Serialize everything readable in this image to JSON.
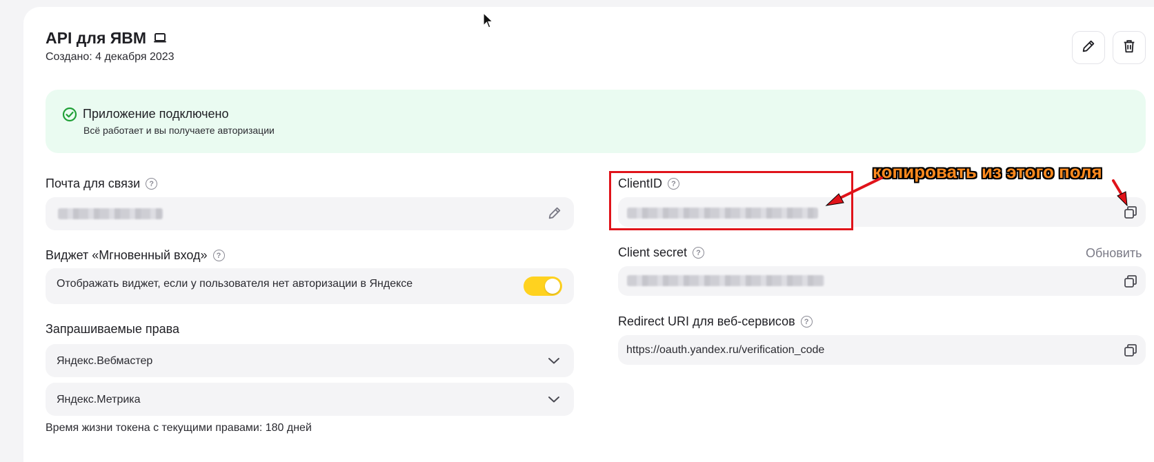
{
  "header": {
    "title": "API для ЯВМ",
    "created": "Создано: 4 декабря 2023"
  },
  "actions": {
    "edit_icon": "pencil-icon",
    "delete_icon": "trash-icon"
  },
  "banner": {
    "title": "Приложение подключено",
    "subtitle": "Всё работает и вы получаете авторизации",
    "status_color": "#21a038"
  },
  "contact": {
    "label": "Почта для связи"
  },
  "widget": {
    "label": "Виджет «Мгновенный вход»",
    "description": "Отображать виджет, если у пользователя нет авторизации в Яндексе",
    "enabled": true,
    "accent": "#ffd21f"
  },
  "rights": {
    "label": "Запрашиваемые права",
    "items": [
      {
        "label": "Яндекс.Вебмастер"
      },
      {
        "label": "Яндекс.Метрика"
      }
    ],
    "token_lifetime": "Время жизни токена с текущими правами: 180 дней"
  },
  "client_id": {
    "label": "ClientID"
  },
  "client_secret": {
    "label": "Client secret",
    "refresh": "Обновить"
  },
  "redirect": {
    "label": "Redirect URI для веб-сервисов",
    "value": "https://oauth.yandex.ru/verification_code"
  },
  "annotation": {
    "text": "копировать из этого поля",
    "color": "#e0131a"
  }
}
